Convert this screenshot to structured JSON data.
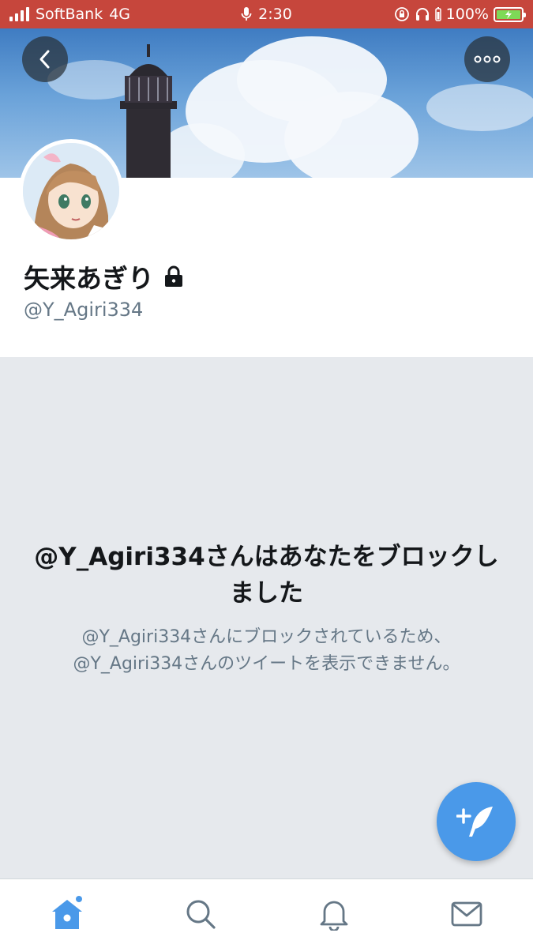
{
  "status_bar": {
    "carrier": "SoftBank",
    "network": "4G",
    "time": "2:30",
    "battery": "100%"
  },
  "header": {
    "back_icon": "chevron-left-icon",
    "more_icon": "more-horizontal-icon"
  },
  "profile": {
    "display_name": "矢来あぎり",
    "handle": "@Y_Agiri334",
    "protected_icon": "lock-icon"
  },
  "blocked": {
    "title": "@Y_Agiri334さんはあなたをブロックしました",
    "description": "@Y_Agiri334さんにブロックされているため、@Y_Agiri334さんのツイートを表示できません。"
  },
  "compose": {
    "icon": "compose-tweet-icon"
  },
  "tab_bar": {
    "tabs": [
      {
        "name": "home",
        "icon": "home-icon",
        "active": true
      },
      {
        "name": "search",
        "icon": "search-icon",
        "active": false
      },
      {
        "name": "notifications",
        "icon": "bell-icon",
        "active": false
      },
      {
        "name": "messages",
        "icon": "mail-icon",
        "active": false
      }
    ]
  },
  "colors": {
    "accent": "#4a99e9",
    "status_bar": "#c6463c",
    "panel_bg": "#e6e9ed",
    "secondary_text": "#657786"
  }
}
